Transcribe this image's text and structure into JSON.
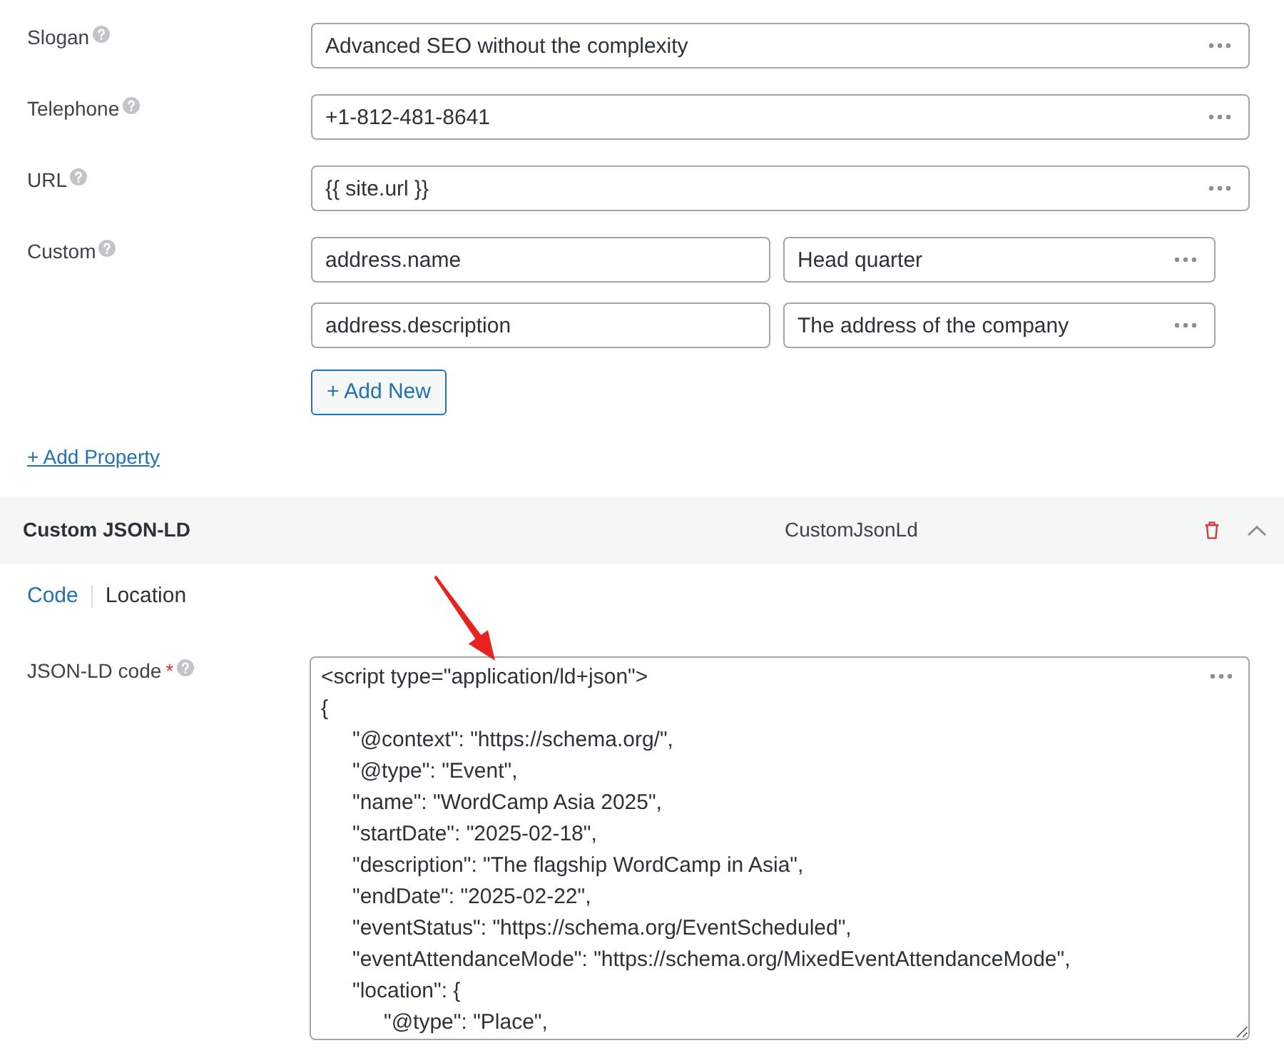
{
  "fields": [
    {
      "label": "Slogan",
      "help_icon": true,
      "value": "Advanced SEO without the complexity"
    },
    {
      "label": "Telephone",
      "help_icon": true,
      "value": "+1-812-481-8641"
    },
    {
      "label": "URL",
      "help_icon": true,
      "value": "{{ site.url }}"
    }
  ],
  "custom": {
    "label": "Custom",
    "help_icon": true,
    "properties": [
      {
        "key": "address.name",
        "value": "Head quarter"
      },
      {
        "key": "address.description",
        "value": "The address of the company"
      }
    ],
    "add_button": "+ Add New"
  },
  "add_property_link": "+ Add Property",
  "section": {
    "title": "Custom JSON-LD",
    "type": "CustomJsonLd",
    "expanded": true,
    "tabs": [
      {
        "label": "Code",
        "selected": true
      },
      {
        "label": "Location",
        "selected": false
      }
    ],
    "code_field": {
      "label": "JSON-LD code",
      "required_mark": "*",
      "help_icon": true,
      "value": "<script type=\"application/ld+json\">\n{\n\t\"@context\": \"https://schema.org/\",\n\t\"@type\": \"Event\",\n\t\"name\": \"WordCamp Asia 2025\",\n\t\"startDate\": \"2025-02-18\",\n\t\"description\": \"The flagship WordCamp in Asia\",\n\t\"endDate\": \"2025-02-22\",\n\t\"eventStatus\": \"https://schema.org/EventScheduled\",\n\t\"eventAttendanceMode\": \"https://schema.org/MixedEventAttendanceMode\",\n\t\"location\": {\n\t\t\"@type\": \"Place\","
    }
  }
}
